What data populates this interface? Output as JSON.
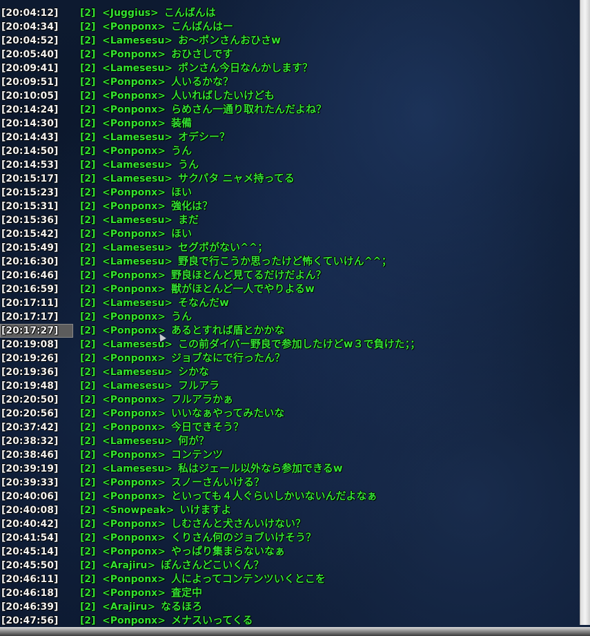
{
  "chat": {
    "lines": [
      {
        "time": "[20:04:12]",
        "channel": "[2]",
        "speaker": "<Juggius>",
        "message": "こんばんは"
      },
      {
        "time": "[20:04:34]",
        "channel": "[2]",
        "speaker": "<Ponponx>",
        "message": "こんばんはー"
      },
      {
        "time": "[20:04:52]",
        "channel": "[2]",
        "speaker": "<Lamesesu>",
        "message": "お～ポンさんおひさw"
      },
      {
        "time": "[20:05:40]",
        "channel": "[2]",
        "speaker": "<Ponponx>",
        "message": "おひさしです"
      },
      {
        "time": "[20:09:41]",
        "channel": "[2]",
        "speaker": "<Lamesesu>",
        "message": "ポンさん今日なんかします？"
      },
      {
        "time": "[20:09:51]",
        "channel": "[2]",
        "speaker": "<Ponponx>",
        "message": "人いるかな？"
      },
      {
        "time": "[20:10:05]",
        "channel": "[2]",
        "speaker": "<Ponponx>",
        "message": "人いればしたいけども"
      },
      {
        "time": "[20:14:24]",
        "channel": "[2]",
        "speaker": "<Ponponx>",
        "message": "らめさん一通り取れたんだよね？"
      },
      {
        "time": "[20:14:30]",
        "channel": "[2]",
        "speaker": "<Ponponx>",
        "message": "装備"
      },
      {
        "time": "[20:14:43]",
        "channel": "[2]",
        "speaker": "<Lamesesu>",
        "message": "オデシー？"
      },
      {
        "time": "[20:14:50]",
        "channel": "[2]",
        "speaker": "<Ponponx>",
        "message": "うん"
      },
      {
        "time": "[20:14:53]",
        "channel": "[2]",
        "speaker": "<Lamesesu>",
        "message": "うん"
      },
      {
        "time": "[20:15:17]",
        "channel": "[2]",
        "speaker": "<Lamesesu>",
        "message": "サクパタ ニャメ持ってる"
      },
      {
        "time": "[20:15:23]",
        "channel": "[2]",
        "speaker": "<Ponponx>",
        "message": "ほい"
      },
      {
        "time": "[20:15:31]",
        "channel": "[2]",
        "speaker": "<Ponponx>",
        "message": "強化は？"
      },
      {
        "time": "[20:15:36]",
        "channel": "[2]",
        "speaker": "<Lamesesu>",
        "message": "まだ"
      },
      {
        "time": "[20:15:42]",
        "channel": "[2]",
        "speaker": "<Ponponx>",
        "message": "ほい"
      },
      {
        "time": "[20:15:49]",
        "channel": "[2]",
        "speaker": "<Lamesesu>",
        "message": "セグポがない^^；"
      },
      {
        "time": "[20:16:30]",
        "channel": "[2]",
        "speaker": "<Lamesesu>",
        "message": "野良で行こうか思ったけど怖くていけん^^；"
      },
      {
        "time": "[20:16:46]",
        "channel": "[2]",
        "speaker": "<Ponponx>",
        "message": "野良ほとんど見てるだけだよん？"
      },
      {
        "time": "[20:16:59]",
        "channel": "[2]",
        "speaker": "<Ponponx>",
        "message": "獣がほとんど一人でやりよるw"
      },
      {
        "time": "[20:17:11]",
        "channel": "[2]",
        "speaker": "<Lamesesu>",
        "message": "そなんだw"
      },
      {
        "time": "[20:17:17]",
        "channel": "[2]",
        "speaker": "<Ponponx>",
        "message": "うん"
      },
      {
        "time": "[20:17:27]",
        "channel": "[2]",
        "speaker": "<Ponponx>",
        "message": "あるとすれば盾とかかな"
      },
      {
        "time": "[20:19:08]",
        "channel": "[2]",
        "speaker": "<Lamesesu>",
        "message": "この前ダイバー野良で参加したけどw３で負けた；；"
      },
      {
        "time": "[20:19:26]",
        "channel": "[2]",
        "speaker": "<Ponponx>",
        "message": "ジョブなにで行ったん？"
      },
      {
        "time": "[20:19:36]",
        "channel": "[2]",
        "speaker": "<Lamesesu>",
        "message": "シかな"
      },
      {
        "time": "[20:19:48]",
        "channel": "[2]",
        "speaker": "<Lamesesu>",
        "message": "フルアラ"
      },
      {
        "time": "[20:20:50]",
        "channel": "[2]",
        "speaker": "<Ponponx>",
        "message": "フルアラかぁ"
      },
      {
        "time": "[20:20:56]",
        "channel": "[2]",
        "speaker": "<Ponponx>",
        "message": "いいなぁやってみたいな"
      },
      {
        "time": "[20:37:42]",
        "channel": "[2]",
        "speaker": "<Ponponx>",
        "message": "今日できそう？"
      },
      {
        "time": "[20:38:32]",
        "channel": "[2]",
        "speaker": "<Lamesesu>",
        "message": "何が？"
      },
      {
        "time": "[20:38:46]",
        "channel": "[2]",
        "speaker": "<Ponponx>",
        "message": "コンテンツ"
      },
      {
        "time": "[20:39:19]",
        "channel": "[2]",
        "speaker": "<Lamesesu>",
        "message": "私はジェール以外なら参加できるw"
      },
      {
        "time": "[20:39:33]",
        "channel": "[2]",
        "speaker": "<Ponponx>",
        "message": "スノーさんいける？"
      },
      {
        "time": "[20:40:06]",
        "channel": "[2]",
        "speaker": "<Ponponx>",
        "message": "といっても４人ぐらいしかいないんだよなぁ"
      },
      {
        "time": "[20:40:08]",
        "channel": "[2]",
        "speaker": "<Snowpeak>",
        "message": "いけますよ"
      },
      {
        "time": "[20:40:42]",
        "channel": "[2]",
        "speaker": "<Ponponx>",
        "message": "しむさんと犬さんいけない？"
      },
      {
        "time": "[20:41:54]",
        "channel": "[2]",
        "speaker": "<Ponponx>",
        "message": "くりさん何のジョブいけそう？"
      },
      {
        "time": "[20:45:14]",
        "channel": "[2]",
        "speaker": "<Ponponx>",
        "message": "やっぱり集まらないなぁ"
      },
      {
        "time": "[20:45:50]",
        "channel": "[2]",
        "speaker": "<Arajiru>",
        "message": "ぽんさんどこいくん？"
      },
      {
        "time": "[20:46:11]",
        "channel": "[2]",
        "speaker": "<Ponponx>",
        "message": "人によってコンテンツいくとこを"
      },
      {
        "time": "[20:46:18]",
        "channel": "[2]",
        "speaker": "<Ponponx>",
        "message": "査定中"
      },
      {
        "time": "[20:46:39]",
        "channel": "[2]",
        "speaker": "<Arajiru>",
        "message": "なるほろ"
      },
      {
        "time": "[20:47:56]",
        "channel": "[2]",
        "speaker": "<Ponponx>",
        "message": "メナスいってくる"
      }
    ],
    "selected_index": 23
  },
  "colors": {
    "timestamp": "#f2f2f2",
    "chat_text": "#34e234",
    "selection": "#5c5c5c",
    "background": "#0a1526"
  }
}
